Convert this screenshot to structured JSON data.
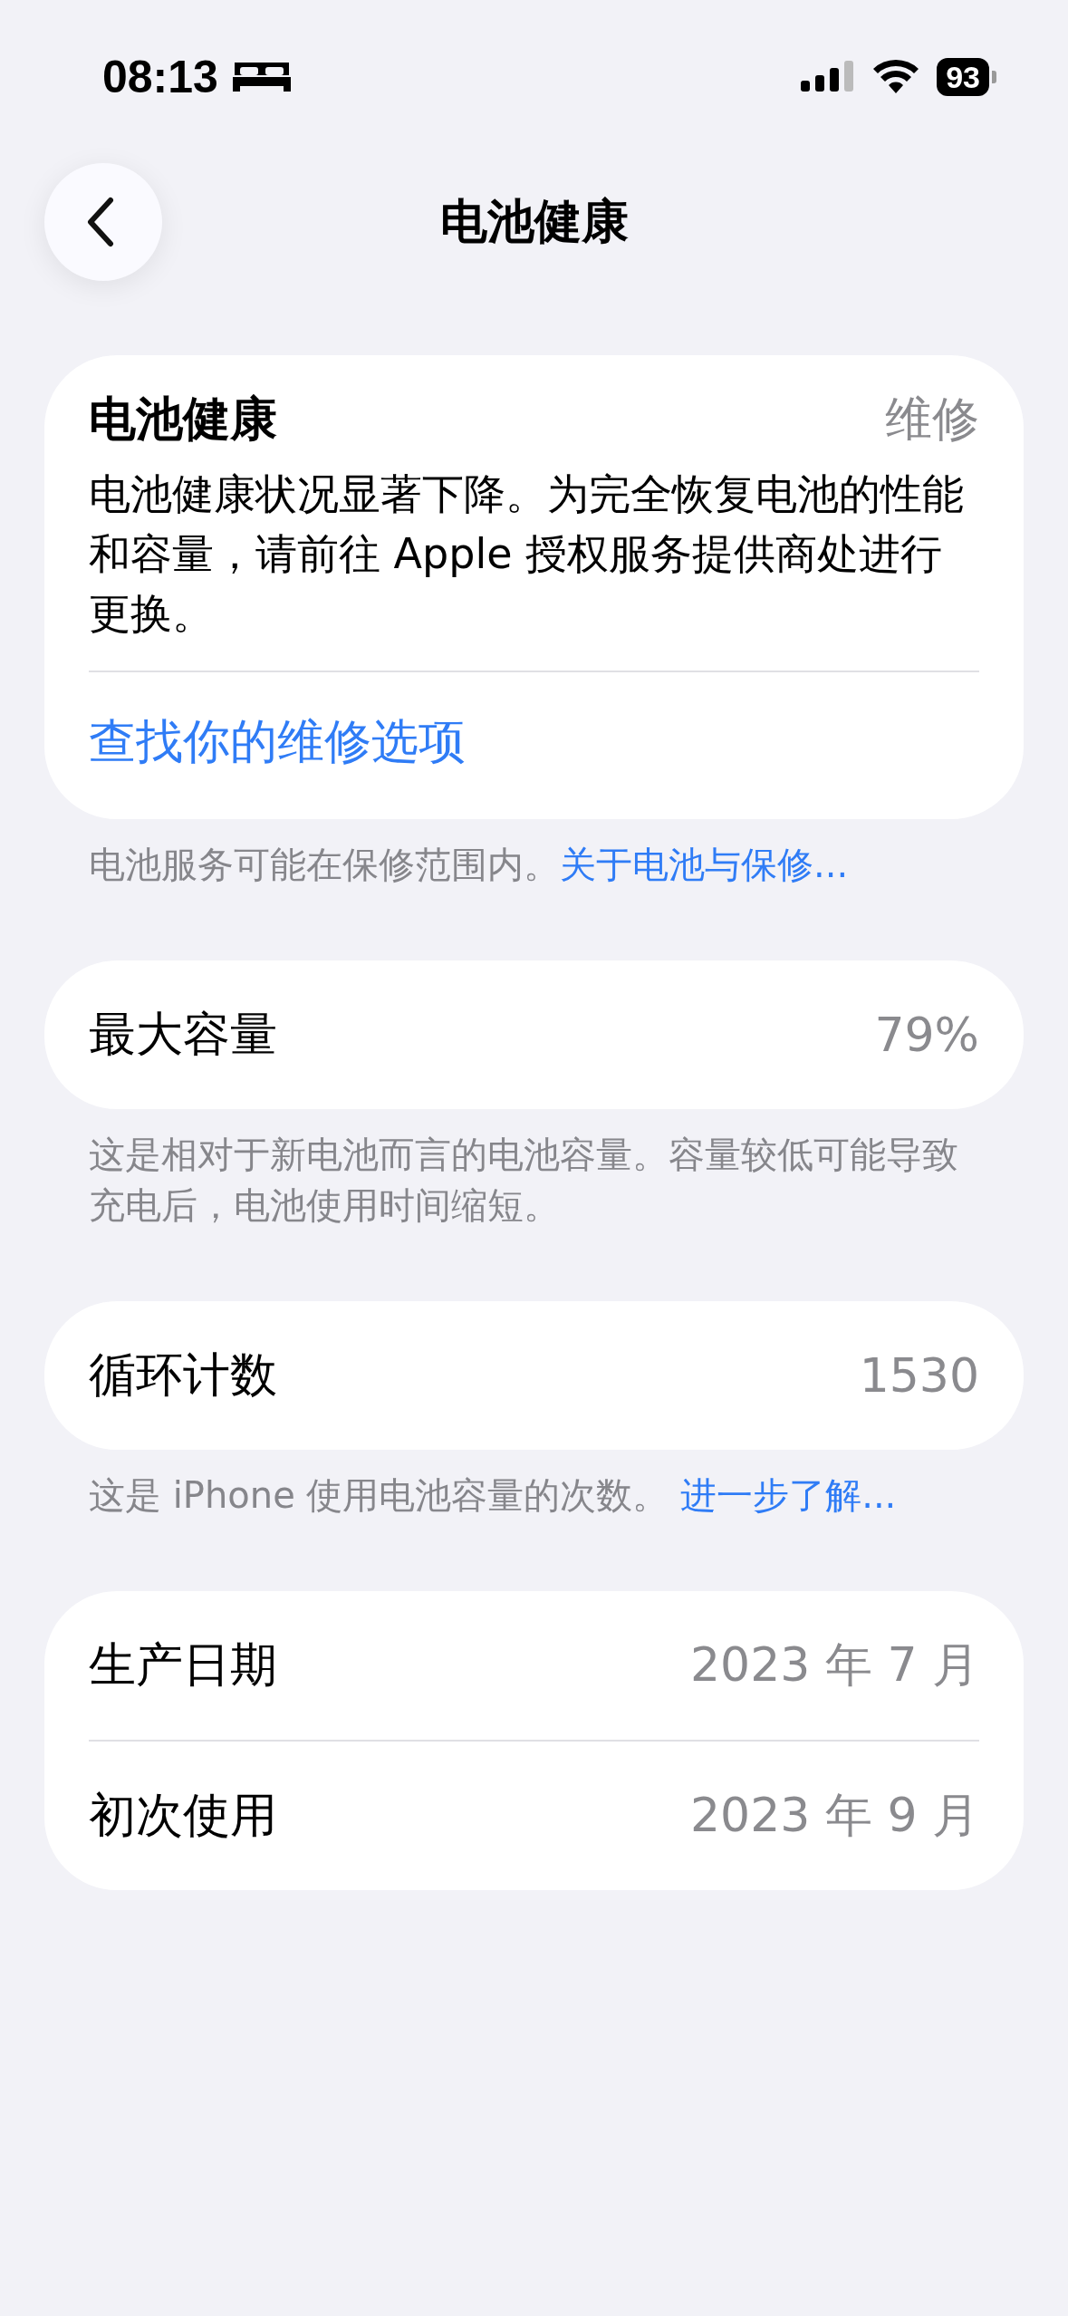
{
  "status_bar": {
    "time": "08:13",
    "battery": "93"
  },
  "nav": {
    "title": "电池健康"
  },
  "health_card": {
    "title": "电池健康",
    "status": "维修",
    "description": "电池健康状况显著下降。为完全恢复电池的性能和容量，请前往 Apple 授权服务提供商处进行更换。",
    "link": "查找你的维修选项"
  },
  "health_footer": {
    "text": "电池服务可能在保修范围内。",
    "link": "关于电池与保修..."
  },
  "groups": [
    {
      "rows": [
        {
          "label": "最大容量",
          "value": "79%"
        }
      ],
      "footer": {
        "text": "这是相对于新电池而言的电池容量。容量较低可能导致充电后，电池使用时间缩短。"
      }
    },
    {
      "rows": [
        {
          "label": "循环计数",
          "value": "1530"
        }
      ],
      "footer": {
        "text": "这是 iPhone 使用电池容量的次数。 ",
        "link": "进一步了解..."
      }
    },
    {
      "rows": [
        {
          "label": "生产日期",
          "value": "2023 年 7 月"
        },
        {
          "label": "初次使用",
          "value": "2023 年 9 月"
        }
      ]
    }
  ]
}
